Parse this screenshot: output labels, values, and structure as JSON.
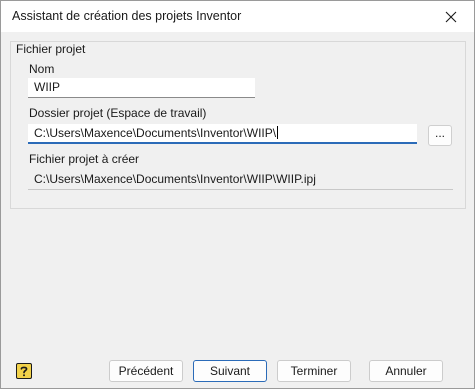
{
  "window": {
    "title": "Assistant de création des projets Inventor"
  },
  "group": {
    "legend": "Fichier projet"
  },
  "name_field": {
    "label": "Nom",
    "value": "WIIP"
  },
  "folder_field": {
    "label": "Dossier projet (Espace de travail)",
    "value": "C:\\Users\\Maxence\\Documents\\Inventor\\WIIP\\",
    "browse_label": "..."
  },
  "project_file_field": {
    "label": "Fichier projet à créer",
    "value": "C:\\Users\\Maxence\\Documents\\Inventor\\WIIP\\WIIP.ipj"
  },
  "buttons": {
    "previous": "Précédent",
    "next": "Suivant",
    "finish": "Terminer",
    "cancel": "Annuler"
  },
  "colors": {
    "accent": "#2b6bb8",
    "help_icon_fill": "#f2d24a"
  },
  "icons": {
    "close": "close-icon",
    "help": "help-icon"
  }
}
